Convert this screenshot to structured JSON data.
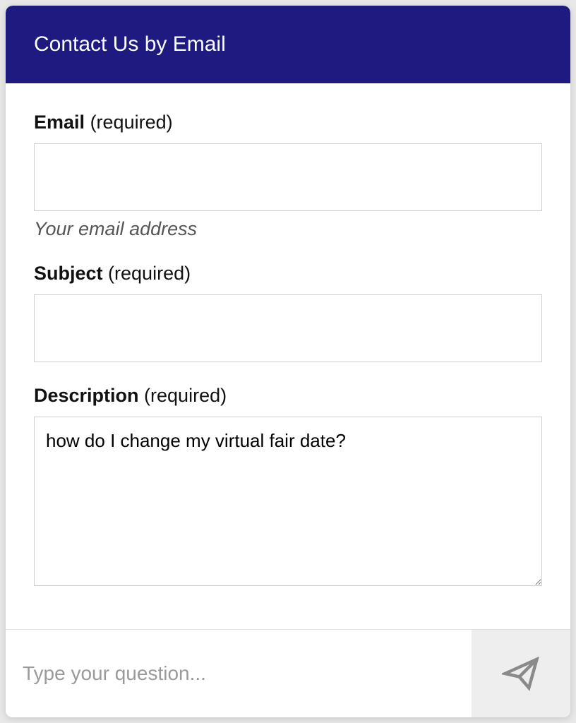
{
  "header": {
    "title": "Contact Us by Email"
  },
  "form": {
    "email": {
      "label": "Email",
      "required_text": "(required)",
      "value": "",
      "hint": "Your email address"
    },
    "subject": {
      "label": "Subject",
      "required_text": "(required)",
      "value": ""
    },
    "description": {
      "label": "Description",
      "required_text": "(required)",
      "value": "how do I change my virtual fair date?"
    }
  },
  "footer": {
    "placeholder": "Type your question...",
    "value": ""
  }
}
